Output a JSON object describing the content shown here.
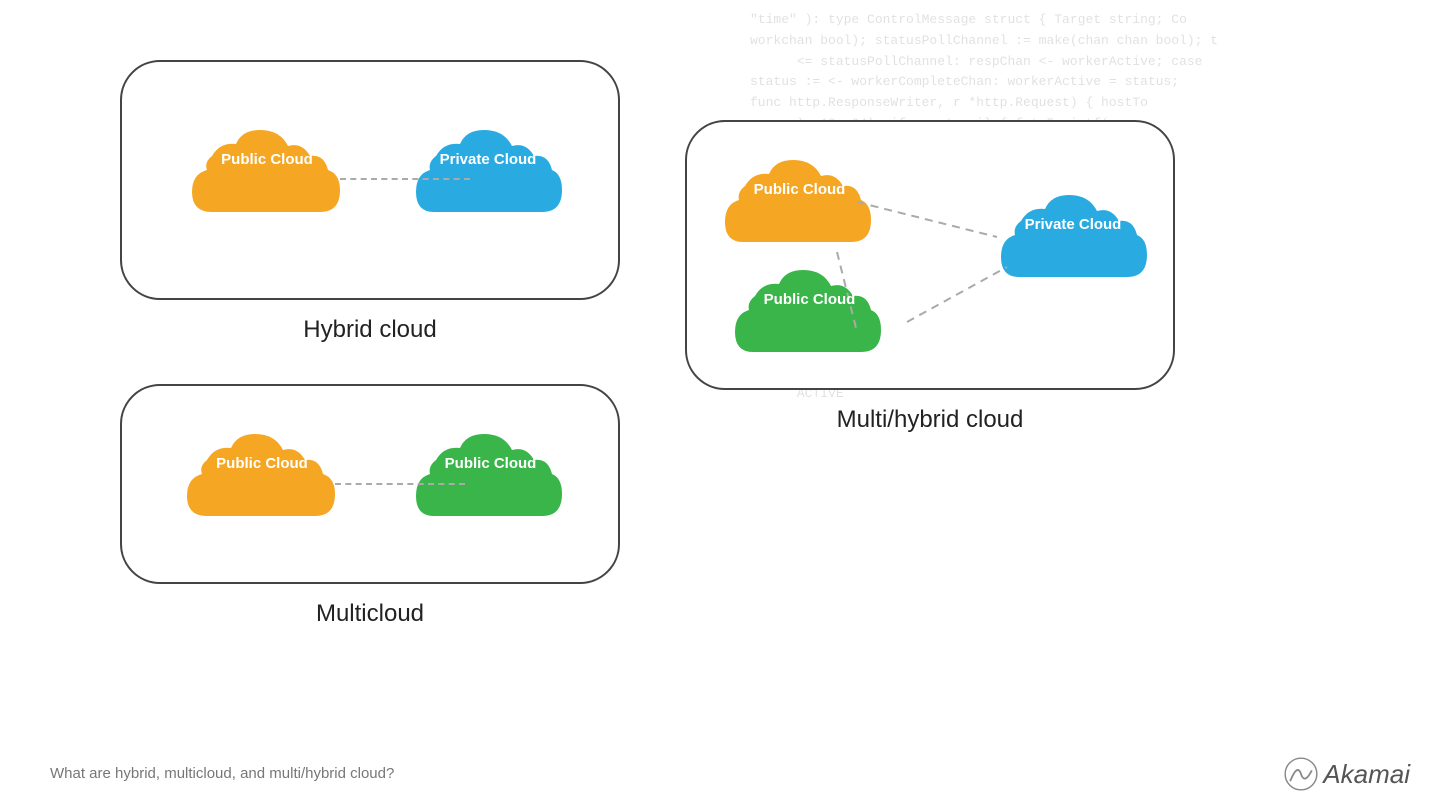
{
  "code_bg": "\"time\" ): type ControlMessage struct { Target string; Co\nworkchan bool); statusPollChannel := make(chan chan bool); t\n      <= statusPollChannel: respChan <- workerActive; case\nstatus := <- workerCompleteChan: workerActive = status;\nfunc http.ResponseWriter, r *http.Request) { hostTo\n      ), 10, 64); if err != nil { fmt.Fprintf(w,\n      fprintf(w, \"Control message issued for Ta\n      ResponseWriter, r *http.Request) { reqChan\n      if result { fmt.Fprint(w, \"ACTIVE\"\n      1337\", nil)); };pa\n      msg.Count   64); }; func ma\n      chan b  4); workerApt\n      ave  ase.msg :=\n      func admin(\n      hostTokens\n      fprintf(w,\n      ied for te\n      reqChan\n      ACTIVE",
  "hybrid_cloud": {
    "title": "Hybrid cloud",
    "cloud1": {
      "label": "Public Cloud",
      "color": "#F5A623"
    },
    "cloud2": {
      "label": "Private Cloud",
      "color": "#29ABE2"
    }
  },
  "multicloud": {
    "title": "Multicloud",
    "cloud1": {
      "label": "Public Cloud",
      "color": "#F5A623"
    },
    "cloud2": {
      "label": "Public Cloud",
      "color": "#39B54A"
    }
  },
  "multi_hybrid_cloud": {
    "title": "Multi/hybrid cloud",
    "cloud1": {
      "label": "Public Cloud",
      "color": "#F5A623"
    },
    "cloud2": {
      "label": "Private Cloud",
      "color": "#29ABE2"
    },
    "cloud3": {
      "label": "Public Cloud",
      "color": "#39B54A"
    }
  },
  "bottom_caption": "What are hybrid, multicloud, and multi/hybrid cloud?",
  "akamai_label": "Akamai"
}
